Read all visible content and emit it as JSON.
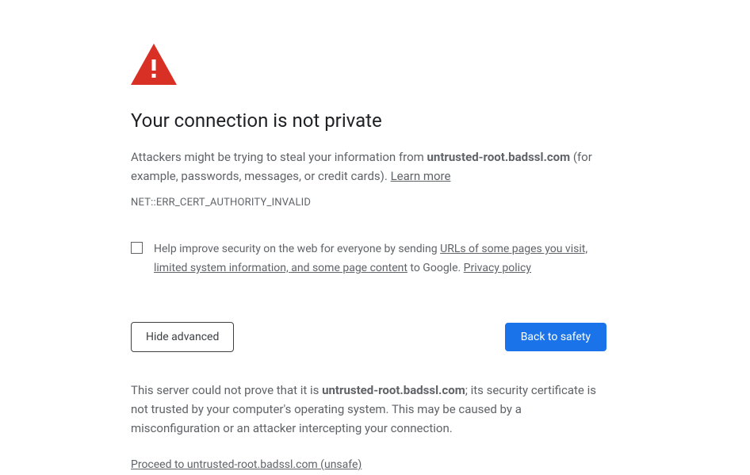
{
  "heading": "Your connection is not private",
  "warning": {
    "prefix": "Attackers might be trying to steal your information from ",
    "domain": "untrusted-root.badssl.com",
    "suffix": " (for example, passwords, messages, or credit cards). ",
    "learn_more": "Learn more"
  },
  "error_code": "NET::ERR_CERT_AUTHORITY_INVALID",
  "opt_in": {
    "prefix": "Help improve security on the web for everyone by sending ",
    "link1": "URLs of some pages you visit, limited system information, and some page content",
    "mid": " to Google. ",
    "link2": "Privacy policy"
  },
  "buttons": {
    "hide_advanced": "Hide advanced",
    "back_to_safety": "Back to safety"
  },
  "advanced": {
    "prefix": "This server could not prove that it is ",
    "domain": "untrusted-root.badssl.com",
    "suffix": "; its security certificate is not trusted by your computer's operating system. This may be caused by a misconfiguration or an attacker intercepting your connection."
  },
  "proceed_link": "Proceed to untrusted-root.badssl.com (unsafe)"
}
